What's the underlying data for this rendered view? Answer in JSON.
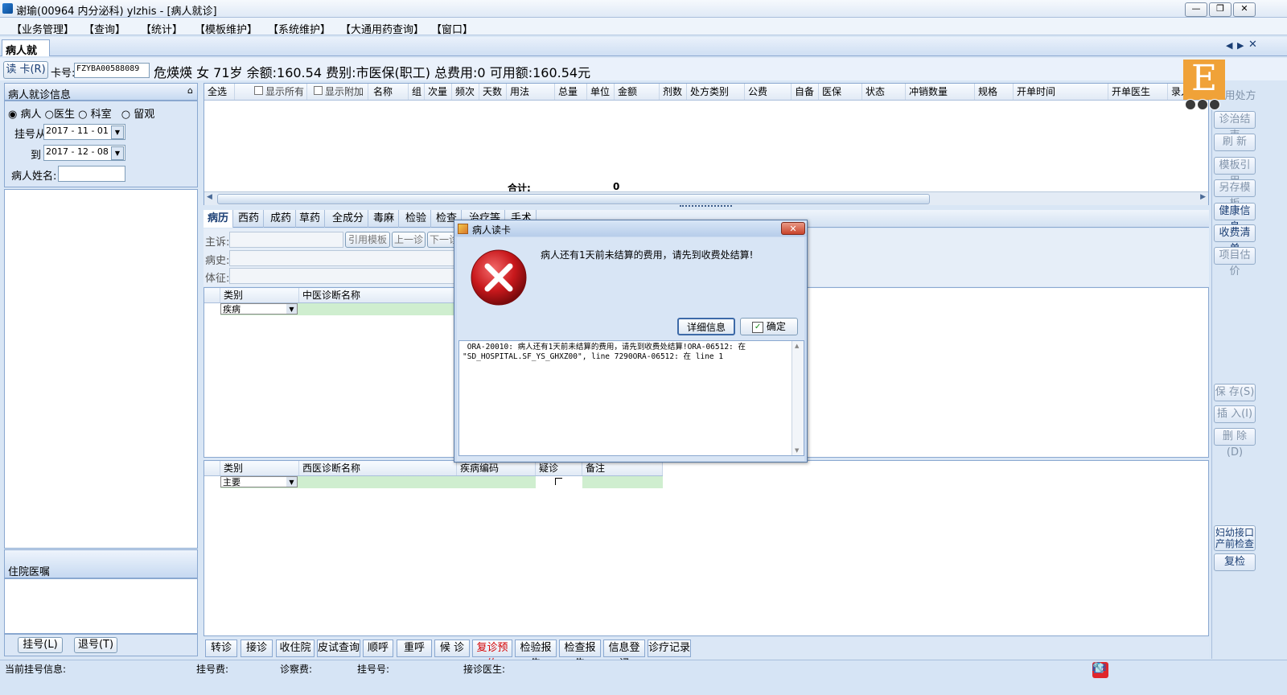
{
  "window": {
    "title": "谢瑜(00964 内分泌科) ylzhis - [病人就诊]",
    "min": "—",
    "max": "❐",
    "close": "✕"
  },
  "menu": [
    "【业务管理】",
    "【查询】",
    "【统计】",
    "【模板维护】",
    "【系统维护】",
    "【大通用药查询】",
    "【窗口】"
  ],
  "doc_tab": "病人就诊",
  "patient": {
    "read_card_button": "读 卡(R)",
    "card_label": "卡号:",
    "card_value": "FZYBA00588089",
    "summary": "危煐煐 女 71岁 余额:160.54 费别:市医保(职工) 总费用:0 可用额:160.54元"
  },
  "left_panel": {
    "title": "病人就诊信息",
    "pin": "⌂",
    "radios": [
      {
        "label": "病人",
        "checked": true
      },
      {
        "label": "医生",
        "checked": false
      },
      {
        "label": "科室",
        "checked": false
      },
      {
        "label": "留观",
        "checked": false
      }
    ],
    "date_from_label": "挂号从",
    "date_from": "2017 - 11 - 01",
    "date_to_label": "到",
    "date_to": "2017 - 12 - 08",
    "name_label": "病人姓名:",
    "name_value": "",
    "orders_title": "住院医嘱",
    "register_button": "挂号(L)",
    "unregister_button": "退号(T)"
  },
  "rx_table": {
    "select_all": "全选",
    "show_all": "显示所有",
    "show_extra": "显示附加",
    "columns": [
      "名称",
      "组",
      "次量",
      "频次",
      "天数",
      "用法",
      "总量",
      "单位",
      "金额",
      "剂数",
      "处方类别",
      "公费",
      "自备",
      "医保",
      "状态",
      "冲销数量",
      "规格",
      "开单时间",
      "开单医生",
      "录入"
    ],
    "total_label": "合计:",
    "total_value": "0"
  },
  "sub_tabs": [
    "病历",
    "西药",
    "成药",
    "草药",
    "全成分",
    "毒麻",
    "检验",
    "检查",
    "治疗等",
    "手术"
  ],
  "record": {
    "chief_label": "主诉:",
    "history_label": "病史:",
    "exam_label": "体征:",
    "ref_template_button": "引用模板",
    "prev_visit_button": "上一诊",
    "next_visit_button": "下一诊"
  },
  "tcm_grid": {
    "columns": [
      "类别",
      "中医诊断名称"
    ],
    "row_type": "疾病"
  },
  "wm_grid": {
    "columns": [
      "类别",
      "西医诊断名称",
      "疾病编码",
      "疑诊",
      "备注"
    ],
    "row_type": "主要"
  },
  "dialog": {
    "title": "病人读卡",
    "message": "病人还有1天前未结算的费用，请先到收费处结算!",
    "details_button": "详细信息",
    "ok_button": "确定",
    "detail_text": " ORA-20010: 病人还有1天前未结算的费用，请先到收费处结算!ORA-06512: 在\n\"SD_HOSPITAL.SF_YS_GHXZ00\", line 7290ORA-06512: 在 line 1"
  },
  "right_buttons": [
    "用处方",
    "诊治结束",
    "刷 新",
    "模板引用",
    "另存模板",
    "健康信息",
    "收费清单",
    "项目估价",
    "保 存(S)",
    "插 入(I)",
    "删 除(D)",
    "妇幼接口 产前检查",
    "复检"
  ],
  "right_buttons_enabled": [
    false,
    false,
    false,
    false,
    false,
    true,
    true,
    false,
    false,
    false,
    false,
    true,
    true
  ],
  "bottom_buttons": [
    "转诊",
    "接诊",
    "收住院",
    "皮试查询",
    "顺呼",
    "重呼",
    "候 诊",
    "复诊预约",
    "检验报告",
    "检查报告",
    "信息登记",
    "诊疗记录"
  ],
  "status": {
    "current": "当前挂号信息:",
    "reg_fee": "挂号费:",
    "consult_fee": "诊察费:",
    "reg_no": "挂号号:",
    "doctor": "接诊医生:"
  },
  "colors": {
    "accent": "#1a3e74",
    "warning": "#d40000",
    "error_icon": "#c8181c",
    "logo": "#f0a238"
  }
}
